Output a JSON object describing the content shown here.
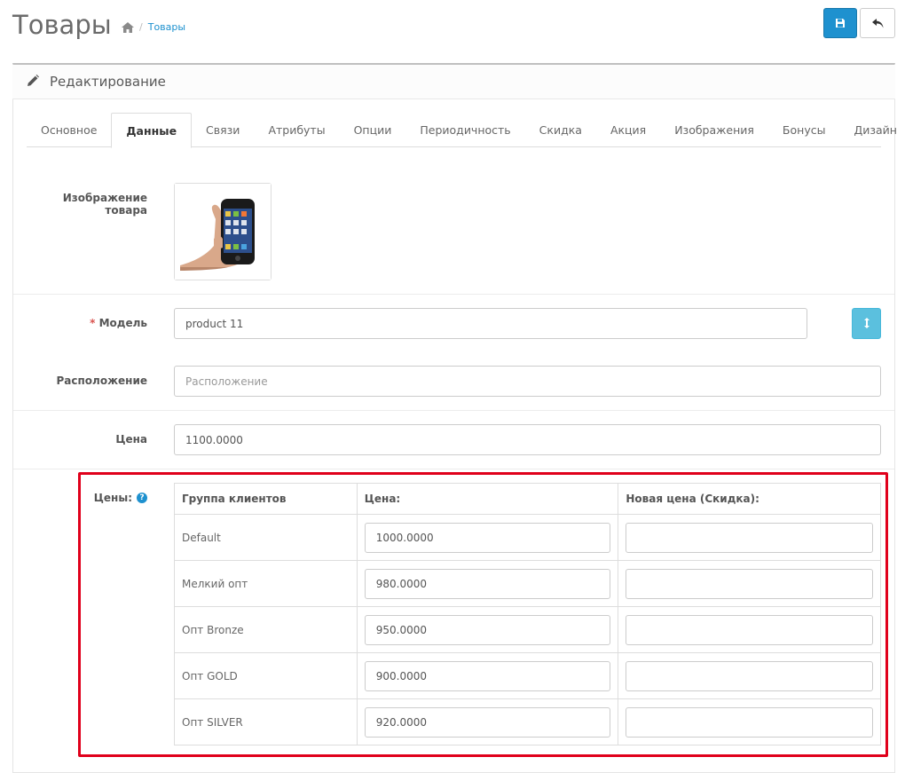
{
  "header": {
    "title": "Товары",
    "breadcrumb_separator": "/",
    "breadcrumb_current": "Товары"
  },
  "panel": {
    "heading": "Редактирование"
  },
  "tabs": [
    {
      "label": "Основное",
      "active": false
    },
    {
      "label": "Данные",
      "active": true
    },
    {
      "label": "Связи",
      "active": false
    },
    {
      "label": "Атрибуты",
      "active": false
    },
    {
      "label": "Опции",
      "active": false
    },
    {
      "label": "Периодичность",
      "active": false
    },
    {
      "label": "Скидка",
      "active": false
    },
    {
      "label": "Акция",
      "active": false
    },
    {
      "label": "Изображения",
      "active": false
    },
    {
      "label": "Бонусы",
      "active": false
    },
    {
      "label": "Дизайн",
      "active": false
    }
  ],
  "form": {
    "image_label": "Изображение товара",
    "model_required": "*",
    "model_label": "Модель",
    "model_value": "product 11",
    "location_label": "Расположение",
    "location_placeholder": "Расположение",
    "price_label": "Цена",
    "price_value": "1100.0000"
  },
  "prices": {
    "label": "Цены:",
    "help": "?",
    "columns": [
      "Группа клиентов",
      "Цена:",
      "Новая цена (Скидка):"
    ],
    "rows": [
      {
        "group": "Default",
        "price": "1000.0000",
        "discount": ""
      },
      {
        "group": "Мелкий опт",
        "price": "980.0000",
        "discount": ""
      },
      {
        "group": "Опт Bronze",
        "price": "950.0000",
        "discount": ""
      },
      {
        "group": "Опт GOLD",
        "price": "900.0000",
        "discount": ""
      },
      {
        "group": "Опт SILVER",
        "price": "920.0000",
        "discount": ""
      }
    ]
  },
  "colors": {
    "primary": "#1e91cf",
    "info": "#5bc0de",
    "highlight": "#e0001b",
    "required": "#d9534f"
  }
}
